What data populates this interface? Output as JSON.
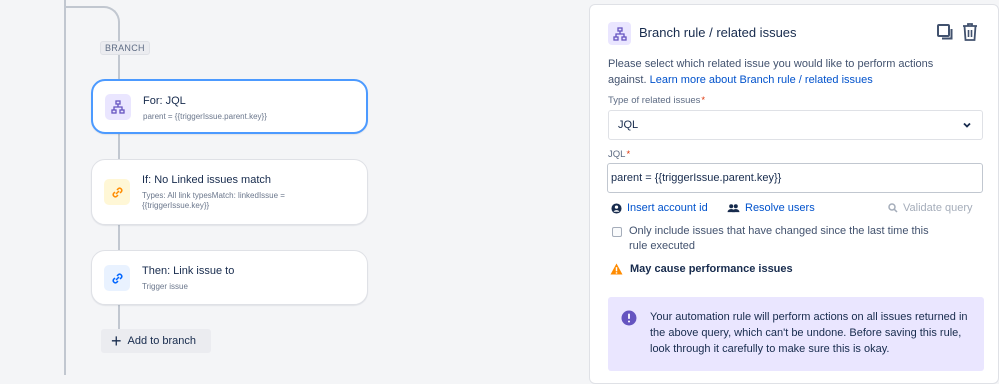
{
  "branch": {
    "label": "BRANCH"
  },
  "cards": [
    {
      "title": "For: JQL",
      "subtitle": "parent = {{triggerIssue.parent.key}}",
      "icon": "branch-icon"
    },
    {
      "title": "If: No Linked issues match",
      "subtitle": "Types: All link typesMatch: linkedIssue = {{triggerIssue.key}}",
      "icon": "link-icon"
    },
    {
      "title": "Then: Link issue to",
      "subtitle": "Trigger issue",
      "icon": "link-icon"
    }
  ],
  "add_to_branch": {
    "icon": "plus-icon",
    "label": "Add to branch"
  },
  "panel": {
    "icon": "branch-icon",
    "title": "Branch rule / related issues",
    "copy_icon": "copy-icon",
    "delete_icon": "trash-icon",
    "description": "Please select which related issue you would like to perform actions against.",
    "learn_more": "Learn more about Branch rule / related issues",
    "type_label": "Type of related issues",
    "type_value": "JQL",
    "jql_label": "JQL",
    "jql_value": "parent = {{triggerIssue.parent.key}}",
    "insert_account_id": "Insert account id",
    "resolve_users": "Resolve users",
    "validate_query": "Validate query",
    "checkbox_label": "Only include issues that have changed since the last time this rule executed",
    "checkbox_checked": false,
    "warning": "May cause performance issues",
    "info": "Your automation rule will perform actions on all issues returned in the above query, which can't be undone. Before saving this rule, look through it carefully to make sure this is okay."
  },
  "colors": {
    "accent_blue": "#0052cc",
    "selected_border": "#4c9aff",
    "branch_icon_bg": "#eae6ff",
    "condition_icon_bg": "#fff7d6",
    "action_icon_bg": "#e9f2ff",
    "warning": "#ff8b00",
    "info_bg": "#eae6ff"
  }
}
